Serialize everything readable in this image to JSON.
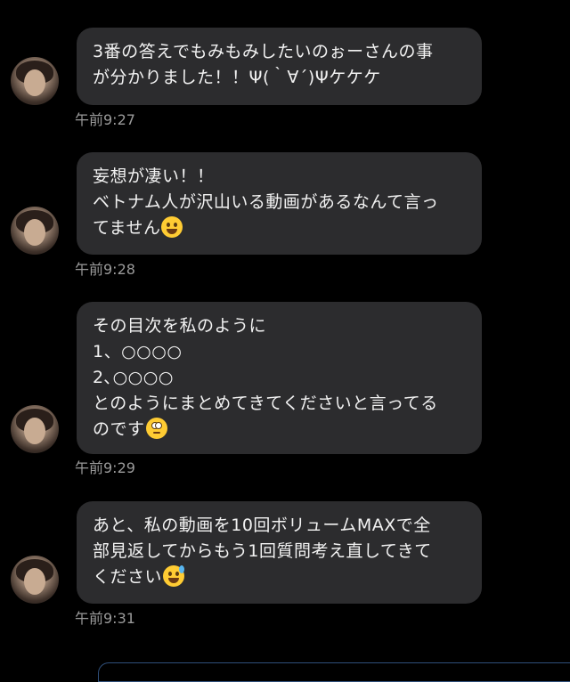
{
  "messages": [
    {
      "text": "3番の答えでもみもみしたいのぉーさんの事\nが分かりました！！Ψ(｀∀´)Ψケケケ",
      "time": "午前9:27",
      "emoji": ""
    },
    {
      "text": "妄想が凄い！！\nベトナム人が沢山いる動画があるなんて言っ\nてません",
      "time": "午前9:28",
      "emoji": "rolling-on-floor-laughing-emoji"
    },
    {
      "text": "その目次を私のように\n1、○○○○\n2､○○○○\nとのようにまとめてきてくださいと言ってる\nのです",
      "time": "午前9:29",
      "emoji": "face-with-rolling-eyes-emoji"
    },
    {
      "text": "あと、私の動画を10回ボリュームMAXで全\n部見返してからもう1回質問考え直してきて\nください",
      "time": "午前9:31",
      "emoji": "grinning-face-with-sweat-emoji"
    }
  ],
  "colors": {
    "background": "#000000",
    "bubble": "#2c2c2e",
    "text": "#f2f2f2",
    "timestamp": "#9a9a9a"
  }
}
